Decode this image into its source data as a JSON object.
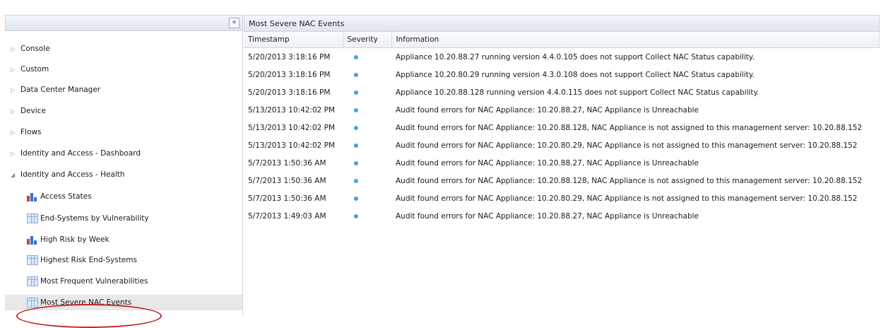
{
  "sidebar": {
    "collapse_glyph": "«",
    "items": [
      {
        "label": "Console",
        "arrow": "▷"
      },
      {
        "label": "Custom",
        "arrow": "▷"
      },
      {
        "label": "Data Center Manager",
        "arrow": "▷"
      },
      {
        "label": "Device",
        "arrow": "▷"
      },
      {
        "label": "Flows",
        "arrow": "▷"
      },
      {
        "label": "Identity and Access - Dashboard",
        "arrow": "▷"
      },
      {
        "label": "Identity and Access - Health",
        "arrow": "◢"
      }
    ],
    "subitems": [
      {
        "label": "Access States",
        "icon": "bar-chart-icon"
      },
      {
        "label": "End-Systems by Vulnerability",
        "icon": "table-icon"
      },
      {
        "label": "High Risk by Week",
        "icon": "bar-chart-icon"
      },
      {
        "label": "Highest Risk End-Systems",
        "icon": "table-icon"
      },
      {
        "label": "Most Frequent Vulnerabilities",
        "icon": "table-icon"
      },
      {
        "label": "Most Severe NAC Events",
        "icon": "table-icon",
        "selected": true
      }
    ]
  },
  "main": {
    "title": "Most Severe NAC Events",
    "columns": [
      "Timestamp",
      "Severity",
      "Information"
    ],
    "severity_color": "#3aa6e0",
    "rows": [
      {
        "timestamp": "5/20/2013 3:18:16 PM",
        "info": "Appliance 10.20.88.27 running version 4.4.0.105 does not support Collect NAC Status capability."
      },
      {
        "timestamp": "5/20/2013 3:18:16 PM",
        "info": "Appliance 10.20.80.29 running version 4.3.0.108 does not support Collect NAC Status capability."
      },
      {
        "timestamp": "5/20/2013 3:18:16 PM",
        "info": "Appliance 10.20.88.128 running version 4.4.0.115 does not support Collect NAC Status capability."
      },
      {
        "timestamp": "5/13/2013 10:42:02 PM",
        "info": "Audit found errors for NAC Appliance: 10.20.88.27, NAC Appliance is Unreachable"
      },
      {
        "timestamp": "5/13/2013 10:42:02 PM",
        "info": "Audit found errors for NAC Appliance: 10.20.88.128, NAC Appliance is not assigned to this management server: 10.20.88.152"
      },
      {
        "timestamp": "5/13/2013 10:42:02 PM",
        "info": "Audit found errors for NAC Appliance: 10.20.80.29, NAC Appliance is not assigned to this management server: 10.20.88.152"
      },
      {
        "timestamp": "5/7/2013 1:50:36 AM",
        "info": "Audit found errors for NAC Appliance: 10.20.88.27, NAC Appliance is Unreachable"
      },
      {
        "timestamp": "5/7/2013 1:50:36 AM",
        "info": "Audit found errors for NAC Appliance: 10.20.88.128, NAC Appliance is not assigned to this management server: 10.20.88.152"
      },
      {
        "timestamp": "5/7/2013 1:50:36 AM",
        "info": "Audit found errors for NAC Appliance: 10.20.80.29, NAC Appliance is not assigned to this management server: 10.20.88.152"
      },
      {
        "timestamp": "5/7/2013 1:49:03 AM",
        "info": "Audit found errors for NAC Appliance: 10.20.88.27, NAC Appliance is Unreachable"
      }
    ]
  }
}
